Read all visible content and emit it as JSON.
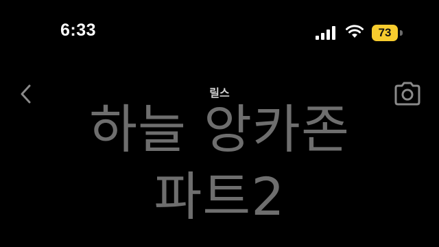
{
  "status_bar": {
    "time": "6:33",
    "battery_level": "73",
    "battery_color": "#f7cc2e",
    "icons": [
      "signal-icon",
      "wifi-icon",
      "battery-icon"
    ]
  },
  "nav": {
    "title": "릴스",
    "left_icon": "back-icon",
    "right_icon": "camera-icon"
  },
  "reel_caption": {
    "line1": "하늘 앙카존",
    "line2": "파트2",
    "text_color": "#6e6e6e"
  }
}
